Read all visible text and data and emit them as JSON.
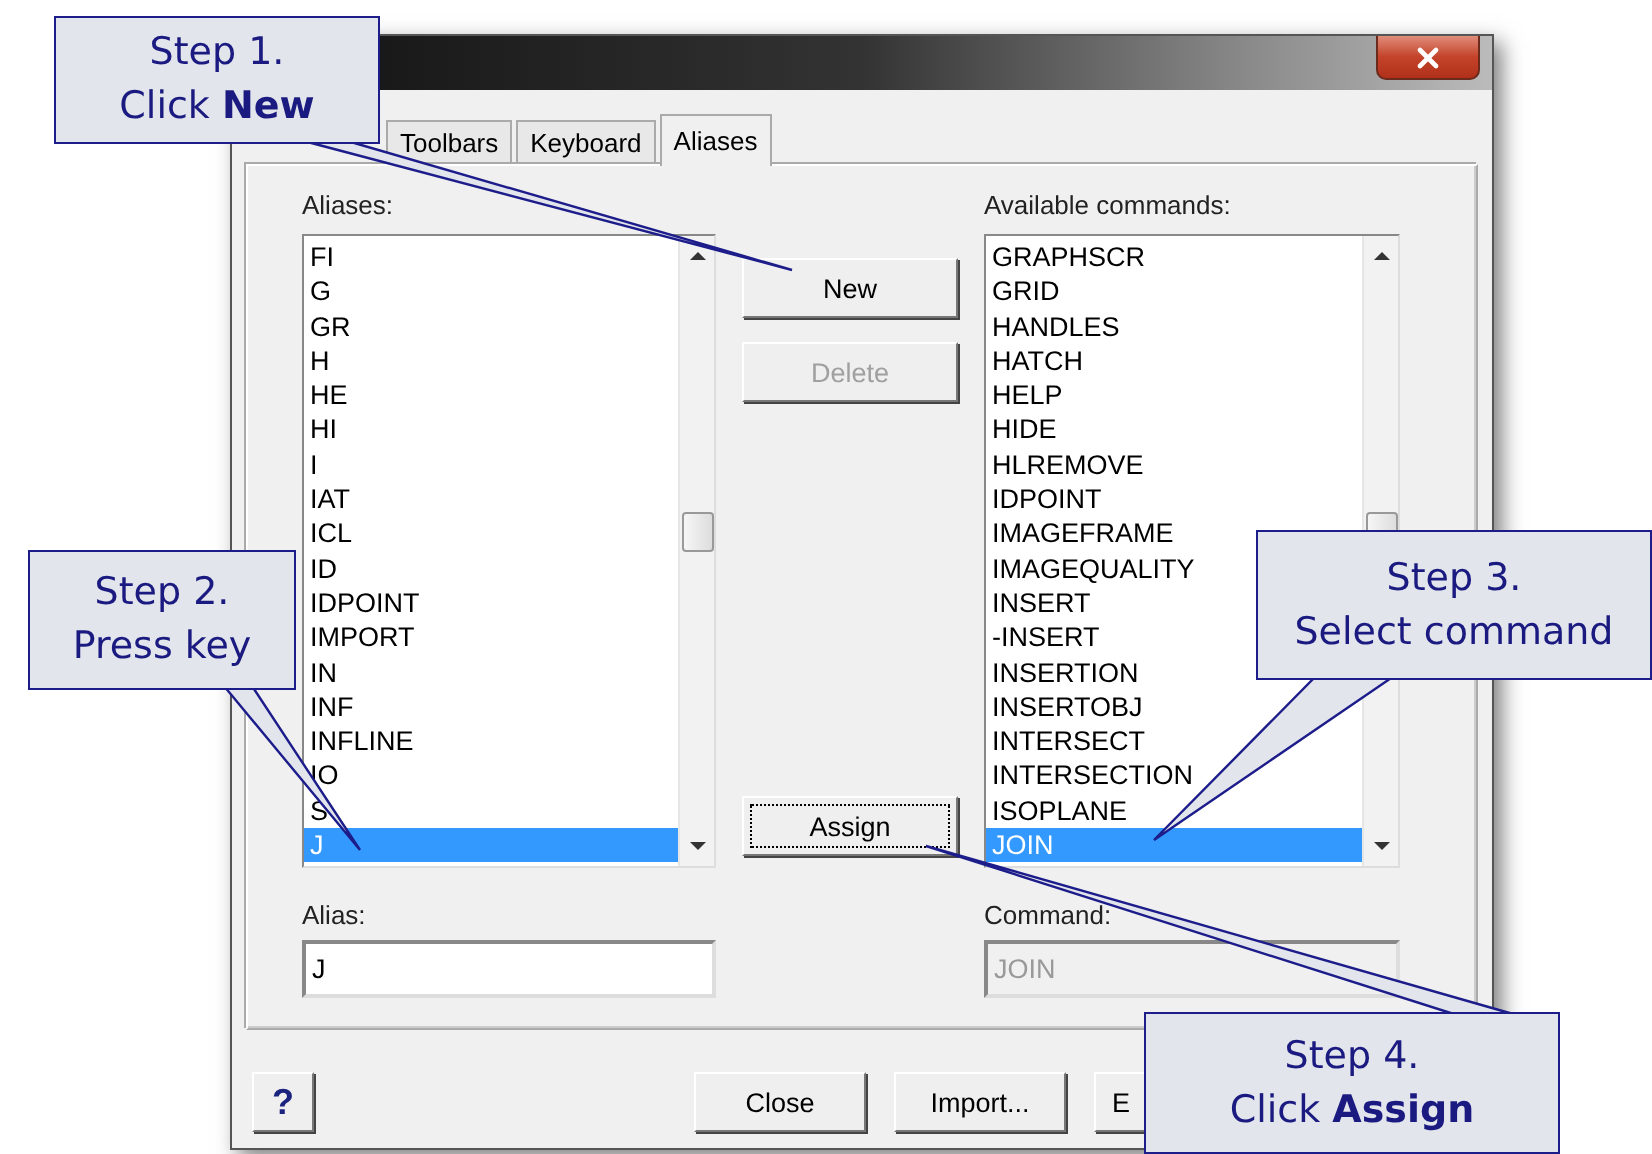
{
  "tabs": [
    {
      "label": "Toolbars",
      "selected": false
    },
    {
      "label": "Keyboard",
      "selected": false
    },
    {
      "label": "Aliases",
      "selected": true
    }
  ],
  "aliases": {
    "label": "Aliases:",
    "items": [
      {
        "text": "FI",
        "selected": false
      },
      {
        "text": "G",
        "selected": false
      },
      {
        "text": "GR",
        "selected": false
      },
      {
        "text": "H",
        "selected": false
      },
      {
        "text": "HE",
        "selected": false
      },
      {
        "text": "HI",
        "selected": false
      },
      {
        "text": "I",
        "selected": false
      },
      {
        "text": "IAT",
        "selected": false
      },
      {
        "text": "ICL",
        "selected": false
      },
      {
        "text": "ID",
        "selected": false
      },
      {
        "text": "IDPOINT",
        "selected": false
      },
      {
        "text": "IMPORT",
        "selected": false
      },
      {
        "text": "IN",
        "selected": false
      },
      {
        "text": "INF",
        "selected": false
      },
      {
        "text": "INFLINE",
        "selected": false
      },
      {
        "text": "IO",
        "selected": false
      },
      {
        "text": "S",
        "selected": false
      },
      {
        "text": "J",
        "selected": true
      }
    ]
  },
  "middle_buttons": [
    {
      "label": "New",
      "disabled": false
    },
    {
      "label": "Delete",
      "disabled": true
    }
  ],
  "assign_button": {
    "label": "Assign"
  },
  "commands": {
    "label": "Available commands:",
    "items": [
      {
        "text": "GRAPHSCR",
        "selected": false
      },
      {
        "text": "GRID",
        "selected": false
      },
      {
        "text": "HANDLES",
        "selected": false
      },
      {
        "text": "HATCH",
        "selected": false
      },
      {
        "text": "HELP",
        "selected": false
      },
      {
        "text": "HIDE",
        "selected": false
      },
      {
        "text": "HLREMOVE",
        "selected": false
      },
      {
        "text": "IDPOINT",
        "selected": false
      },
      {
        "text": "IMAGEFRAME",
        "selected": false
      },
      {
        "text": "IMAGEQUALITY",
        "selected": false
      },
      {
        "text": "INSERT",
        "selected": false
      },
      {
        "text": "-INSERT",
        "selected": false
      },
      {
        "text": "INSERTION",
        "selected": false
      },
      {
        "text": "INSERTOBJ",
        "selected": false
      },
      {
        "text": "INTERSECT",
        "selected": false
      },
      {
        "text": "INTERSECTION",
        "selected": false
      },
      {
        "text": "ISOPLANE",
        "selected": false
      },
      {
        "text": "JOIN",
        "selected": true
      }
    ]
  },
  "alias_field": {
    "label": "Alias:",
    "value": "J",
    "disabled": false
  },
  "command_field": {
    "label": "Command:",
    "value": "JOIN",
    "disabled": true
  },
  "help_button": "?",
  "footer_buttons": [
    "Close",
    "Import...",
    "E"
  ],
  "callouts": [
    {
      "step": "Step 1.",
      "text": "Click **New**"
    },
    {
      "step": "Step 2.",
      "text": "Press key"
    },
    {
      "step": "Step 3.",
      "text": "Select command"
    },
    {
      "step": "Step 4.",
      "text": "Click **Assign**"
    }
  ]
}
